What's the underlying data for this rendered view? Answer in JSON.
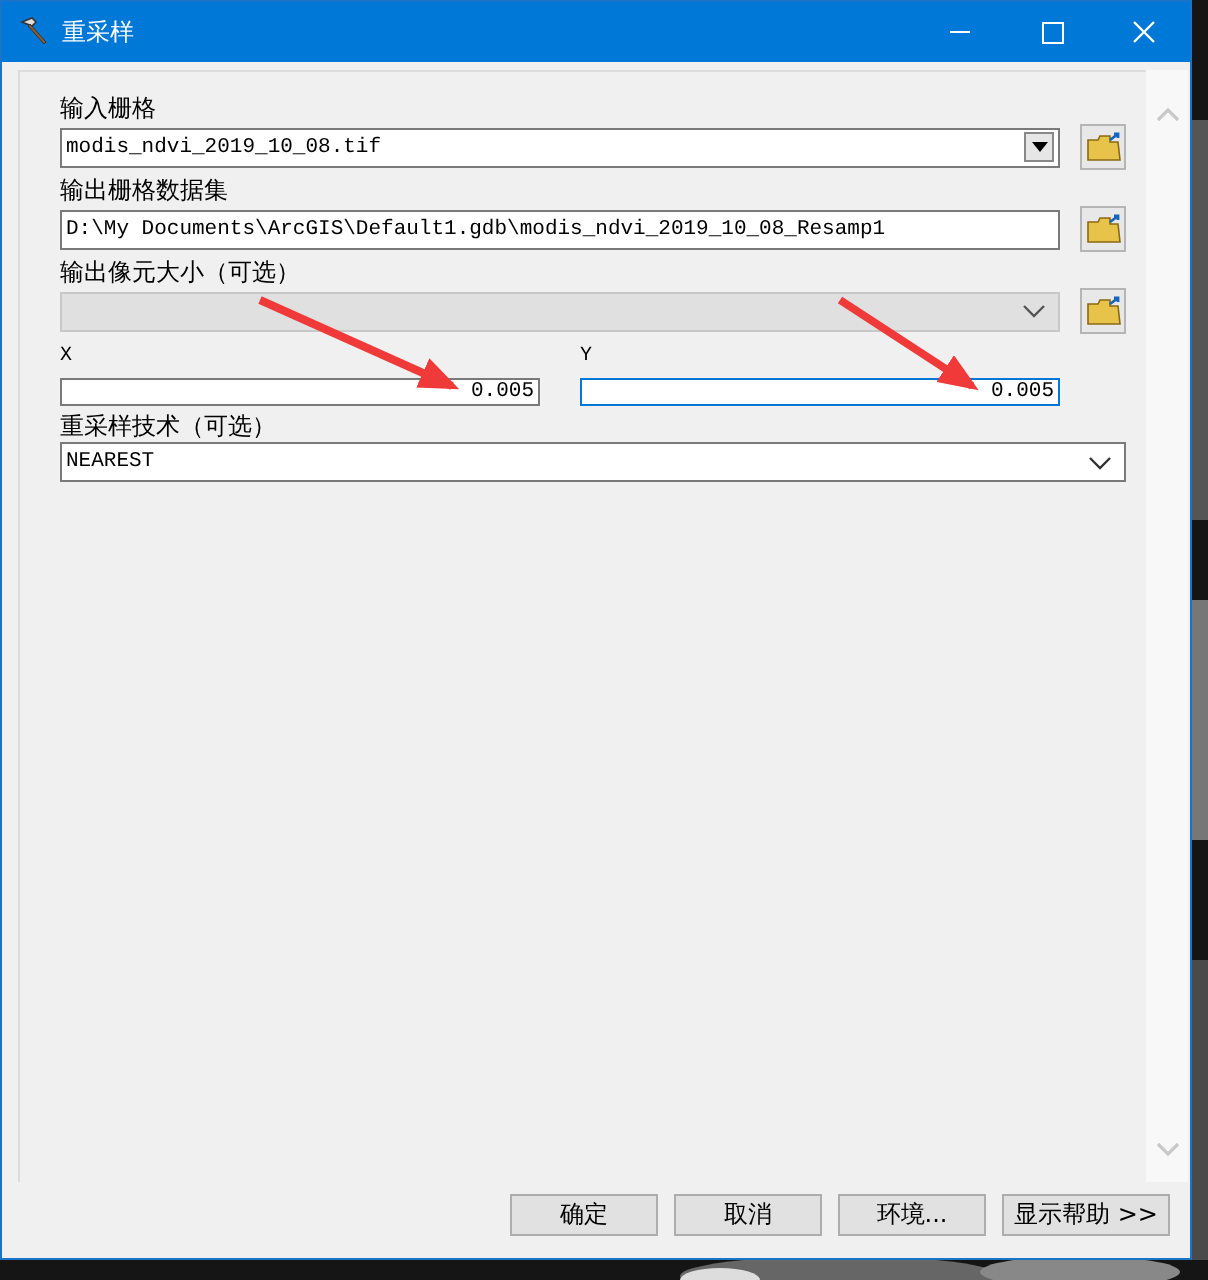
{
  "window": {
    "title": "重采样"
  },
  "fields": [
    {
      "kind": "combo",
      "label": "输入栅格",
      "value": "modis_ndvi_2019_10_08.tif",
      "browse": true
    },
    {
      "kind": "text",
      "label": "输出栅格数据集",
      "value": "D:\\My Documents\\ArcGIS\\Default1.gdb\\modis_ndvi_2019_10_08_Resamp1",
      "browse": true
    },
    {
      "kind": "dropdown",
      "label": "输出像元大小（可选）",
      "disabled": true,
      "browse": true
    },
    {
      "kind": "pair",
      "items": [
        {
          "label": "X",
          "value": "0.005",
          "focused": false
        },
        {
          "label": "Y",
          "value": "0.005",
          "focused": true
        }
      ]
    },
    {
      "kind": "dropdown",
      "label": "重采样技术（可选）",
      "value": "NEAREST",
      "disabled": false
    }
  ],
  "buttons": [
    "确定",
    "取消",
    "环境...",
    "显示帮助 >>"
  ]
}
